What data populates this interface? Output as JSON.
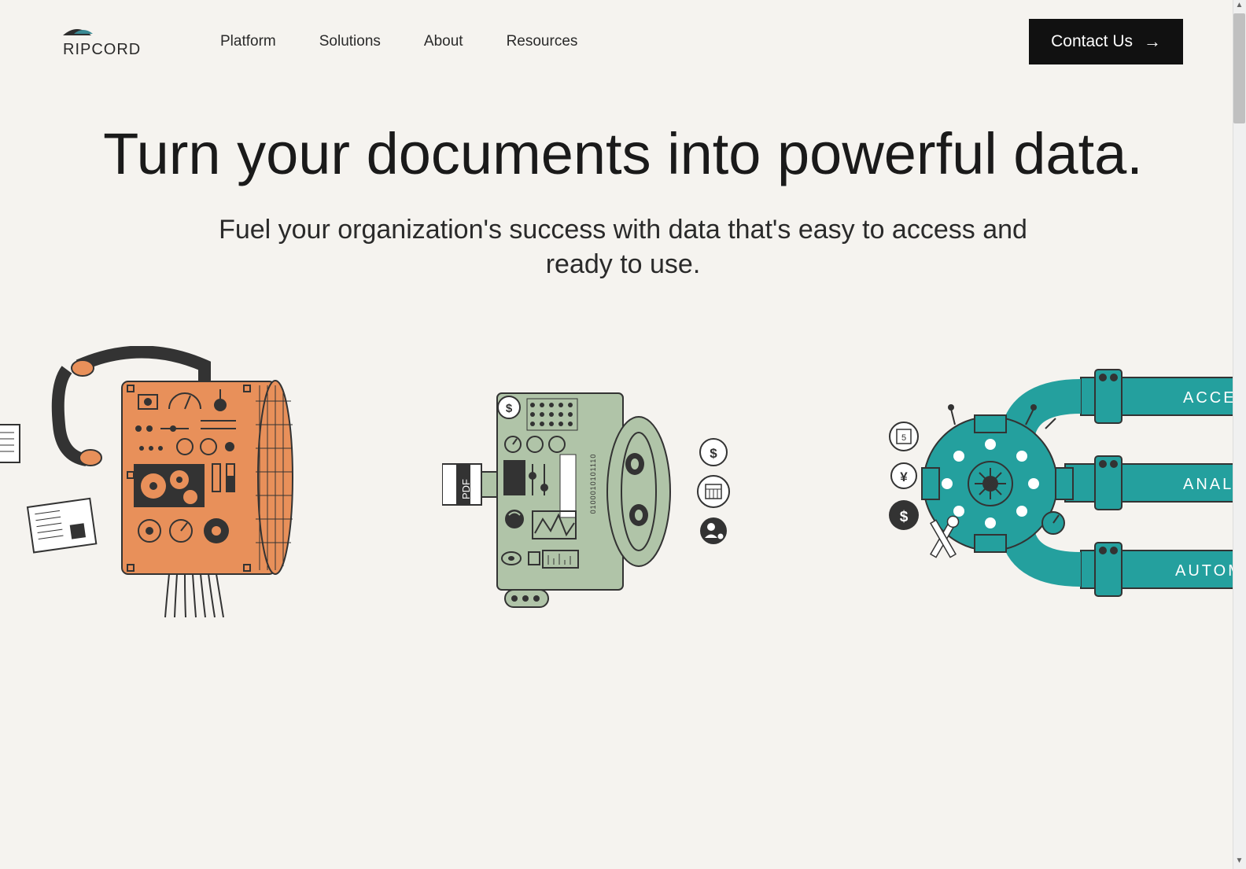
{
  "brand": "RIPCORD",
  "nav": {
    "items": [
      "Platform",
      "Solutions",
      "About",
      "Resources"
    ]
  },
  "cta": {
    "label": "Contact Us"
  },
  "hero": {
    "title": "Turn your documents into powerful data.",
    "subtitle": "Fuel your organization's success with data that's easy to access and ready to use."
  },
  "illustration": {
    "pdf_label": "PDF",
    "binary": "0100010101110",
    "pipes": [
      "ACCESS",
      "ANALYZE",
      "AUTOMATE"
    ],
    "calendar_day": "5",
    "icons": [
      "dollar",
      "calendar",
      "person"
    ]
  },
  "colors": {
    "bg": "#f5f3ef",
    "dark": "#2e2e2e",
    "orange": "#e8905a",
    "sage": "#b0c4a8",
    "teal": "#24a09e"
  }
}
